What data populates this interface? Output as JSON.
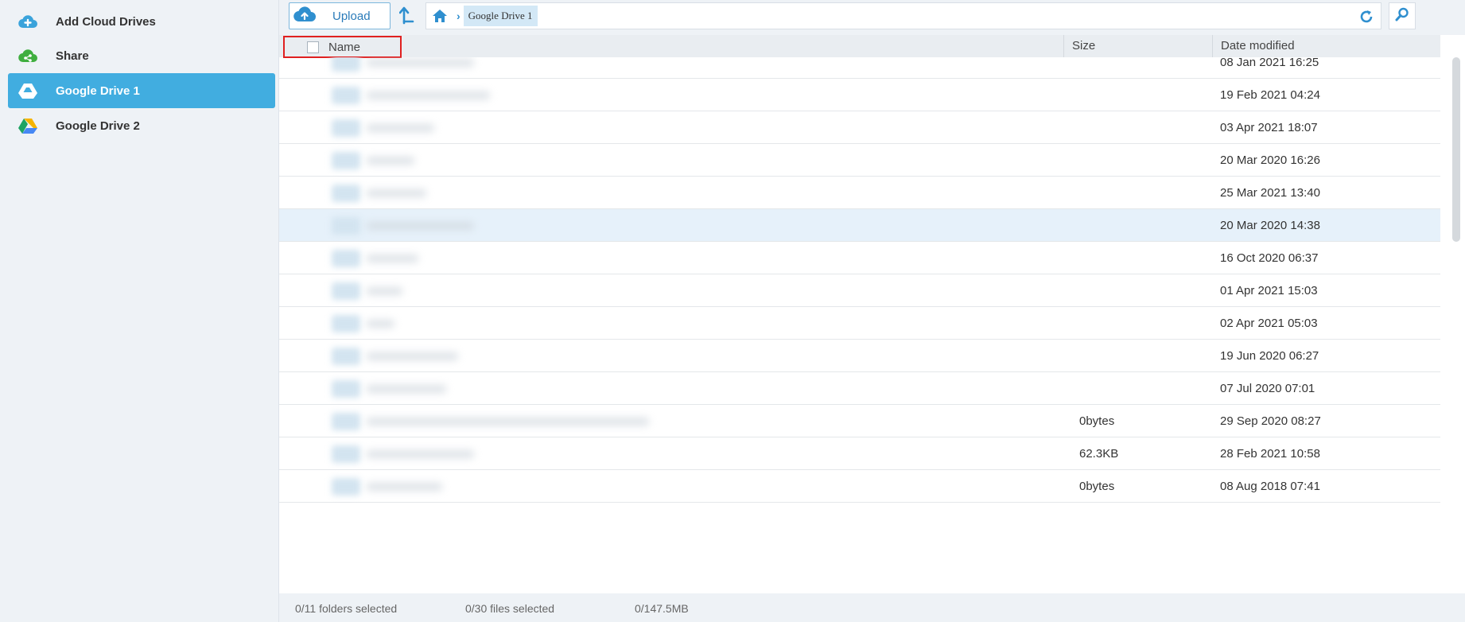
{
  "sidebar": {
    "items": [
      {
        "label": "Add Cloud Drives",
        "icon": "cloud-plus-icon"
      },
      {
        "label": "Share",
        "icon": "share-icon"
      },
      {
        "label": "Google Drive 1",
        "icon": "google-drive-icon",
        "active": true
      },
      {
        "label": "Google Drive 2",
        "icon": "google-drive-icon"
      }
    ]
  },
  "toolbar": {
    "upload_label": "Upload",
    "breadcrumb": [
      "Google Drive 1"
    ]
  },
  "table": {
    "columns": [
      "Name",
      "Size",
      "Date modified"
    ],
    "rows": [
      {
        "size": "",
        "date": "08 Jan 2021 16:25"
      },
      {
        "size": "",
        "date": "19 Feb 2021 04:24"
      },
      {
        "size": "",
        "date": "03 Apr 2021 18:07"
      },
      {
        "size": "",
        "date": "20 Mar 2020 16:26"
      },
      {
        "size": "",
        "date": "25 Mar 2021 13:40"
      },
      {
        "size": "",
        "date": "20 Mar 2020 14:38",
        "selected": true
      },
      {
        "size": "",
        "date": "16 Oct 2020 06:37"
      },
      {
        "size": "",
        "date": "01 Apr 2021 15:03"
      },
      {
        "size": "",
        "date": "02 Apr 2021 05:03"
      },
      {
        "size": "",
        "date": "19 Jun 2020 06:27"
      },
      {
        "size": "",
        "date": "07 Jul 2020 07:01"
      },
      {
        "size": "0bytes",
        "date": "29 Sep 2020 08:27"
      },
      {
        "size": "62.3KB",
        "date": "28 Feb 2021 10:58"
      },
      {
        "size": "0bytes",
        "date": "08 Aug 2018 07:41"
      }
    ]
  },
  "status": {
    "folders": "0/11 folders selected",
    "files": "0/30 files selected",
    "size": "0/147.5MB"
  },
  "colors": {
    "accent": "#41ade0",
    "highlight_border": "#e02020",
    "sidebar_bg": "#eef2f6"
  }
}
